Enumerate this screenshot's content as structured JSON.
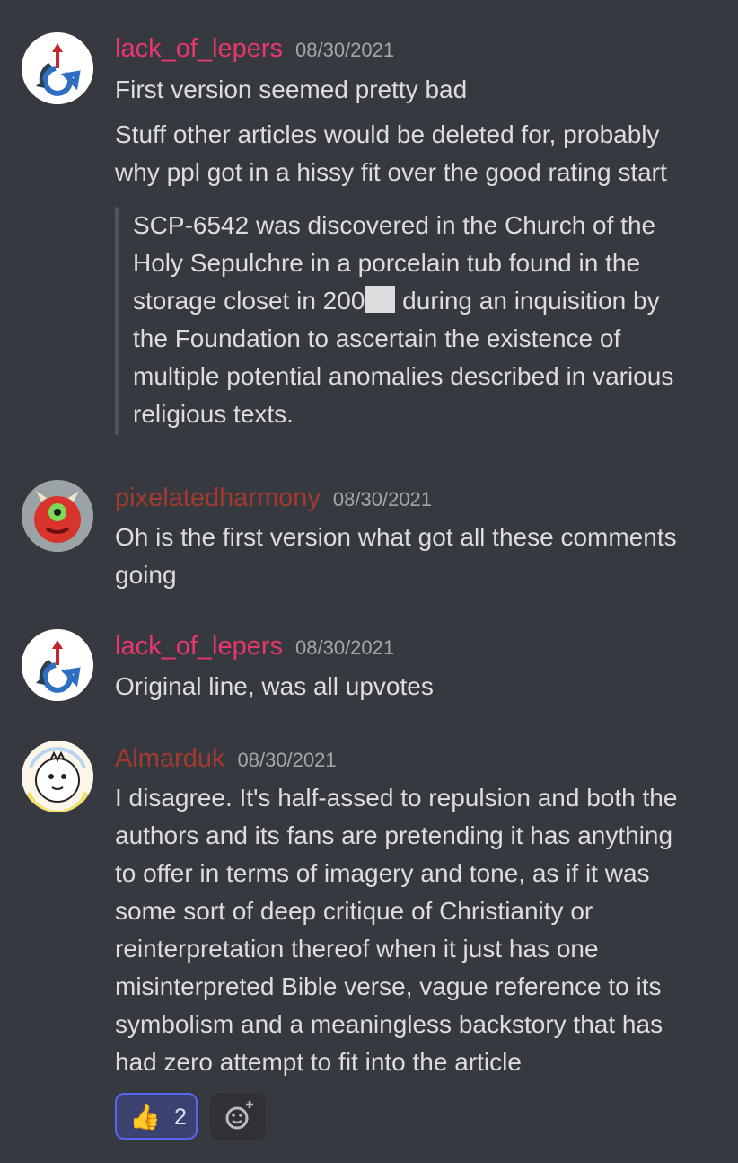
{
  "messages": [
    {
      "username": "lack_of_lepers",
      "username_color": "#e8376b",
      "timestamp": "08/30/2021",
      "lines": [
        "First version seemed pretty bad",
        "Stuff other articles would be deleted for, probably",
        "why ppl got in a hissy fit over the good rating start"
      ],
      "quote_lines": [
        "SCP-6542 was discovered in the Church of the",
        "Holy Sepulchre in a porcelain tub found in the",
        "storage closet in 200",
        " during an inquisition by",
        "the Foundation to ascertain the existence of",
        "multiple potential anomalies described in various",
        "religious texts."
      ]
    },
    {
      "username": "pixelatedharmony",
      "username_color": "#a23a2e",
      "timestamp": "08/30/2021",
      "lines": [
        "Oh is the first version what got all these comments",
        "going"
      ]
    },
    {
      "username": "lack_of_lepers",
      "username_color": "#e8376b",
      "timestamp": "08/30/2021",
      "lines": [
        "Original line, was all upvotes"
      ]
    },
    {
      "username": "Almarduk",
      "username_color": "#a23a2e",
      "timestamp": "08/30/2021",
      "lines": [
        "I disagree. It's half-assed to repulsion and both the",
        "authors and its fans are pretending it has anything",
        "to offer in terms of imagery and tone, as if it was",
        "some sort of deep critique of Christianity or",
        "reinterpretation thereof when it just has one",
        "misinterpreted Bible verse, vague reference to its",
        "symbolism and a meaningless backstory that has",
        "had zero attempt to fit into the article"
      ]
    }
  ],
  "reaction": {
    "emoji": "👍",
    "count": "2",
    "icon": "thumbs-up-icon"
  },
  "add_reaction": {
    "icon": "add-reaction-icon"
  }
}
